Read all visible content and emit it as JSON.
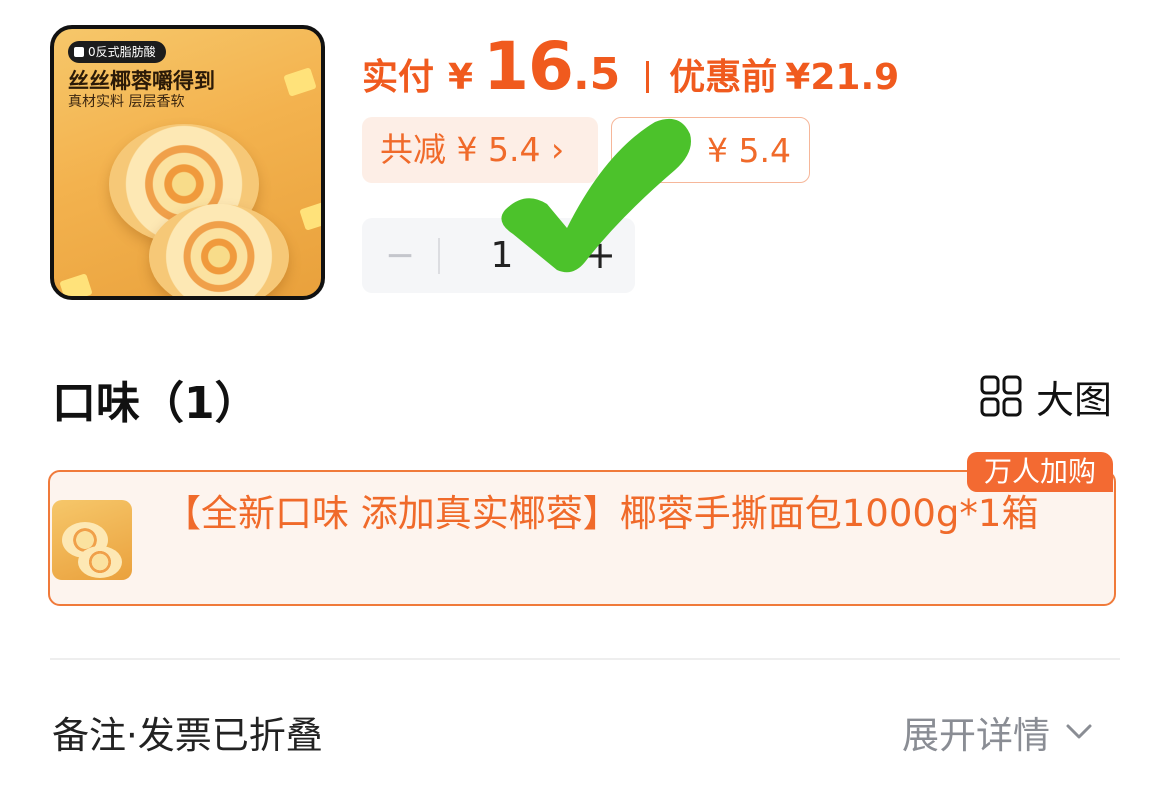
{
  "product": {
    "tag": "0反式脂肪酸",
    "headline": "丝丝椰蓉嚼得到",
    "subline": "真材实料 层层香软"
  },
  "pricing": {
    "paid_label": "实付",
    "currency": "¥",
    "paid_int": "16",
    "paid_dec": ".5",
    "original_label": "优惠前",
    "original_price": "¥21.9",
    "reduction_text": "共减 ¥ 5.4 ›",
    "coupon_text": "¥ 5.4",
    "accent_color": "#f05a1e"
  },
  "stepper": {
    "minus": "−",
    "quantity": "1",
    "plus": "+"
  },
  "overlay": {
    "checkmark_color": "#4cc22b"
  },
  "flavor": {
    "section_title": "口味（1）",
    "big_image_label": "大图",
    "selected_option": "【全新口味 添加真实椰蓉】椰蓉手撕面包1000g*1箱",
    "badge": "万人加购"
  },
  "footer": {
    "notes_label": "备注·发票已折叠",
    "expand_label": "展开详情"
  }
}
